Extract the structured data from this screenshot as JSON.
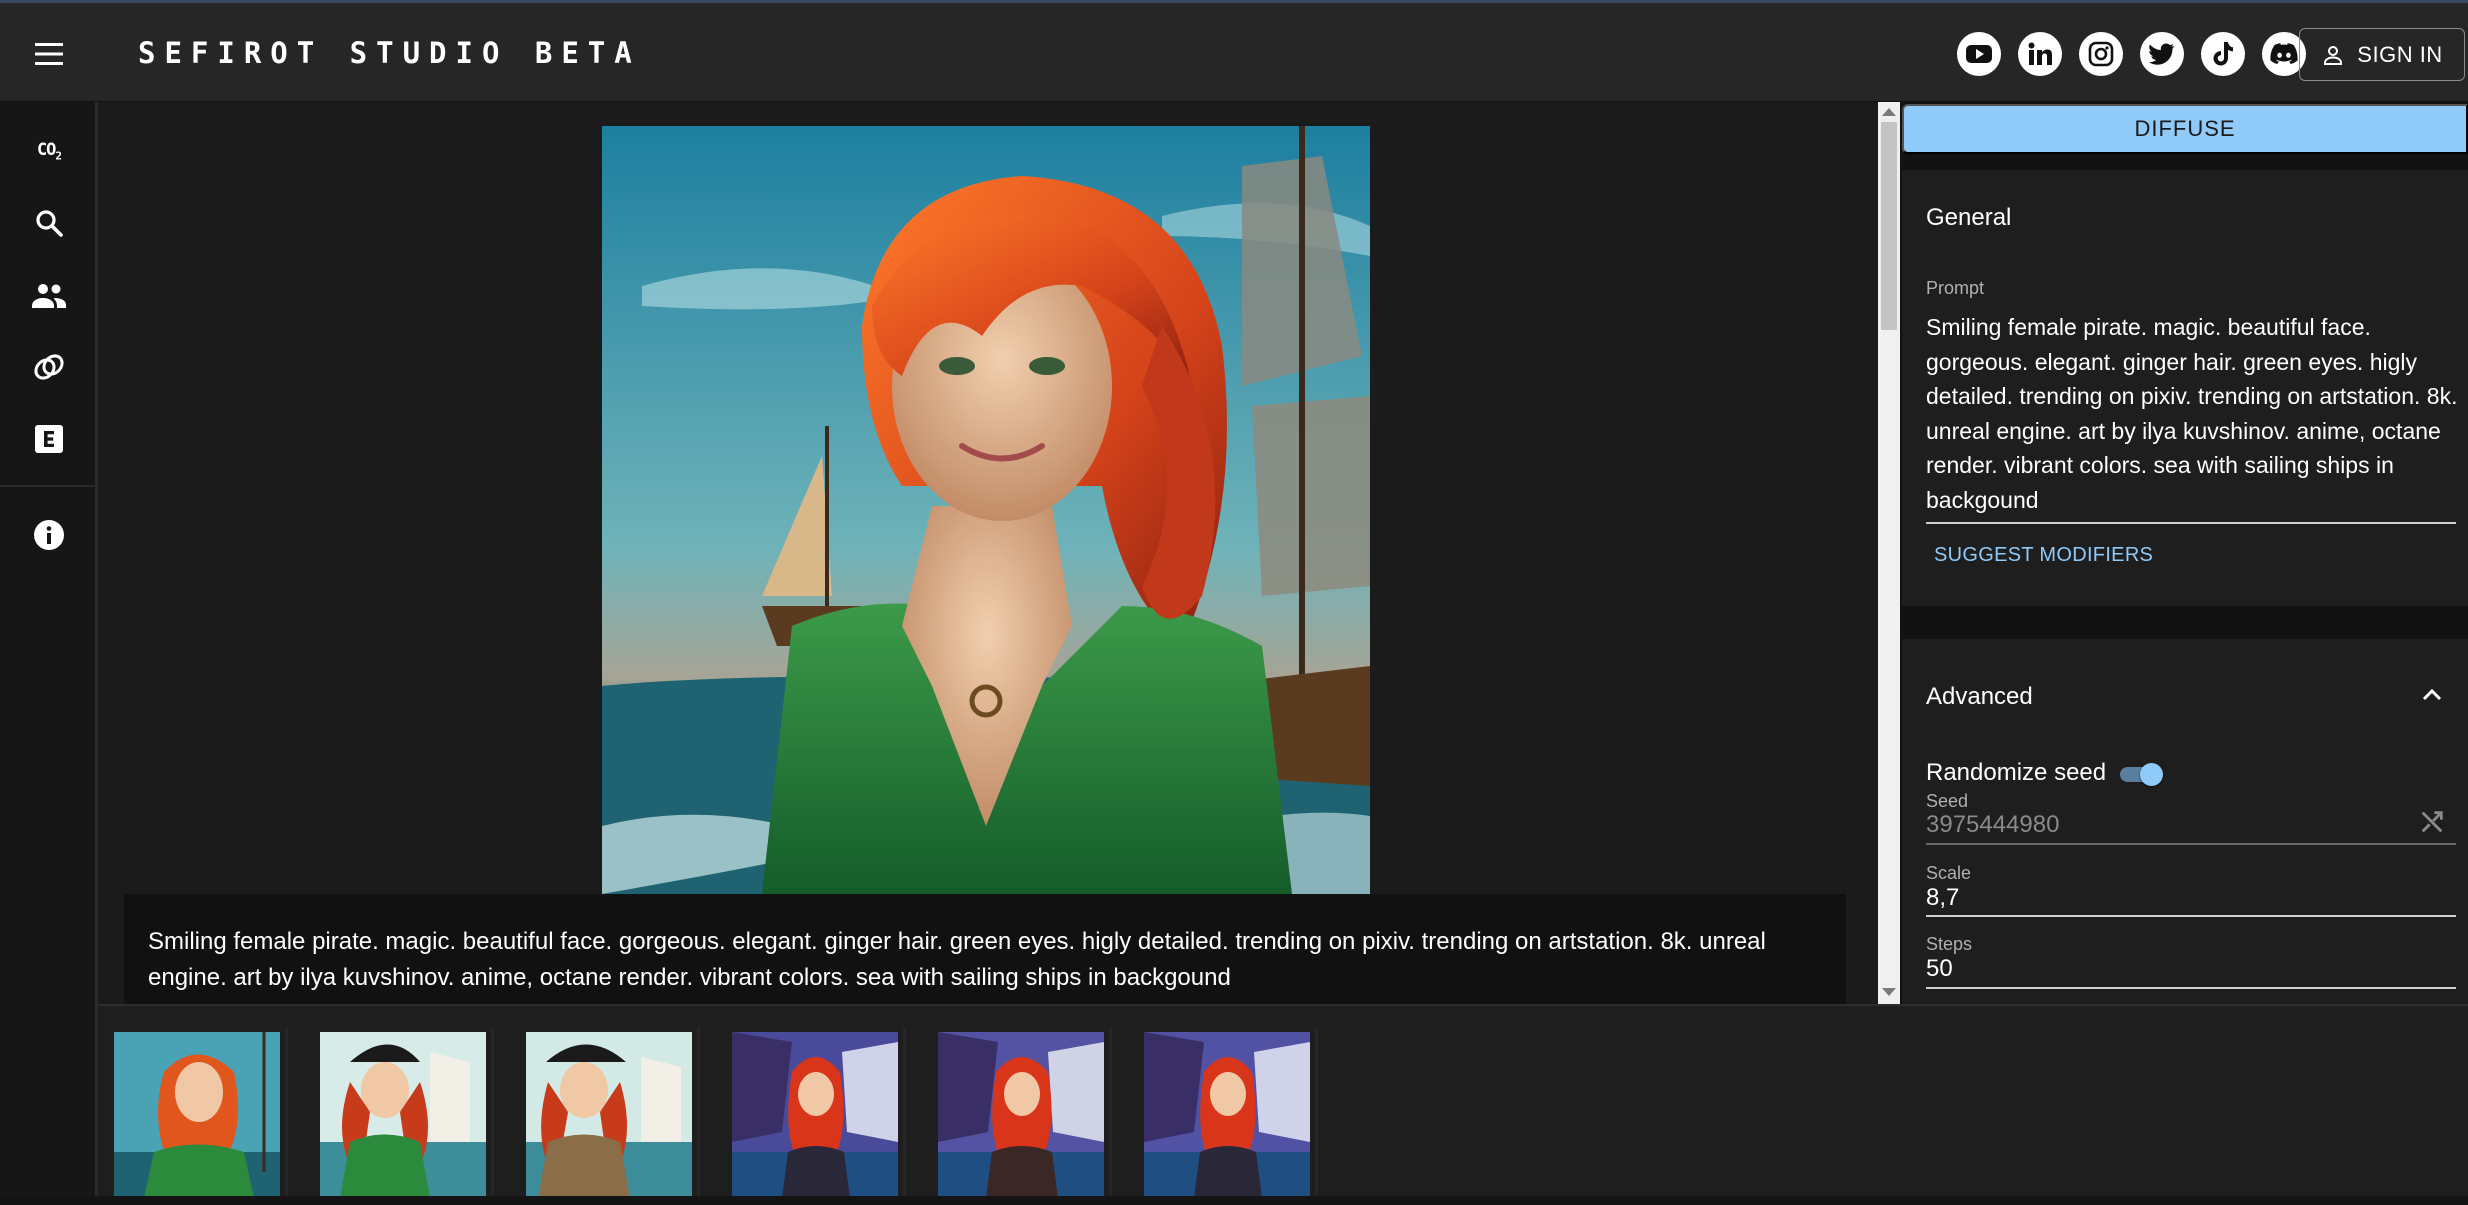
{
  "app": {
    "title": "SEFIROT STUDIO BETA",
    "sign_in_label": "SIGN IN"
  },
  "socials": [
    {
      "name": "youtube-icon"
    },
    {
      "name": "linkedin-icon"
    },
    {
      "name": "instagram-icon"
    },
    {
      "name": "twitter-icon"
    },
    {
      "name": "tiktok-icon"
    },
    {
      "name": "discord-icon"
    }
  ],
  "rail": {
    "co2_label": "CO",
    "co2_sub": "2",
    "items": [
      "co2-icon",
      "search-icon",
      "people-icon",
      "rings-icon",
      "e-box-icon",
      "info-icon"
    ]
  },
  "main": {
    "caption": "Smiling female pirate. magic. beautiful face. gorgeous. elegant. ginger hair. green eyes. higly detailed. trending on pixiv. trending on artstation. 8k. unreal engine. art by ilya kuvshinov. anime, octane render. vibrant colors. sea with sailing ships in backgound"
  },
  "panel": {
    "diffuse_label": "DIFFUSE",
    "general": {
      "title": "General",
      "prompt_label": "Prompt",
      "prompt_value": "Smiling female pirate. magic. beautiful face. gorgeous. elegant. ginger hair. green eyes. higly detailed. trending on pixiv. trending on artstation. 8k. unreal engine. art by ilya kuvshinov. anime, octane render. vibrant colors. sea with sailing ships in backgound",
      "suggest_label": "SUGGEST MODIFIERS"
    },
    "advanced": {
      "title": "Advanced",
      "randomize_label": "Randomize seed",
      "randomize_on": true,
      "seed_label": "Seed",
      "seed_value": "3975444980",
      "scale_label": "Scale",
      "scale_value": "8,7",
      "steps_label": "Steps",
      "steps_value": "50"
    }
  },
  "colors": {
    "accent": "#90caf9",
    "appbar": "#262626",
    "panel": "#1e1e1e"
  },
  "thumbnails": [
    {
      "style": "green-dress"
    },
    {
      "style": "pirate-hat"
    },
    {
      "style": "pirate-hat"
    },
    {
      "style": "purple-ships"
    },
    {
      "style": "purple-ships"
    },
    {
      "style": "purple-ships"
    }
  ]
}
